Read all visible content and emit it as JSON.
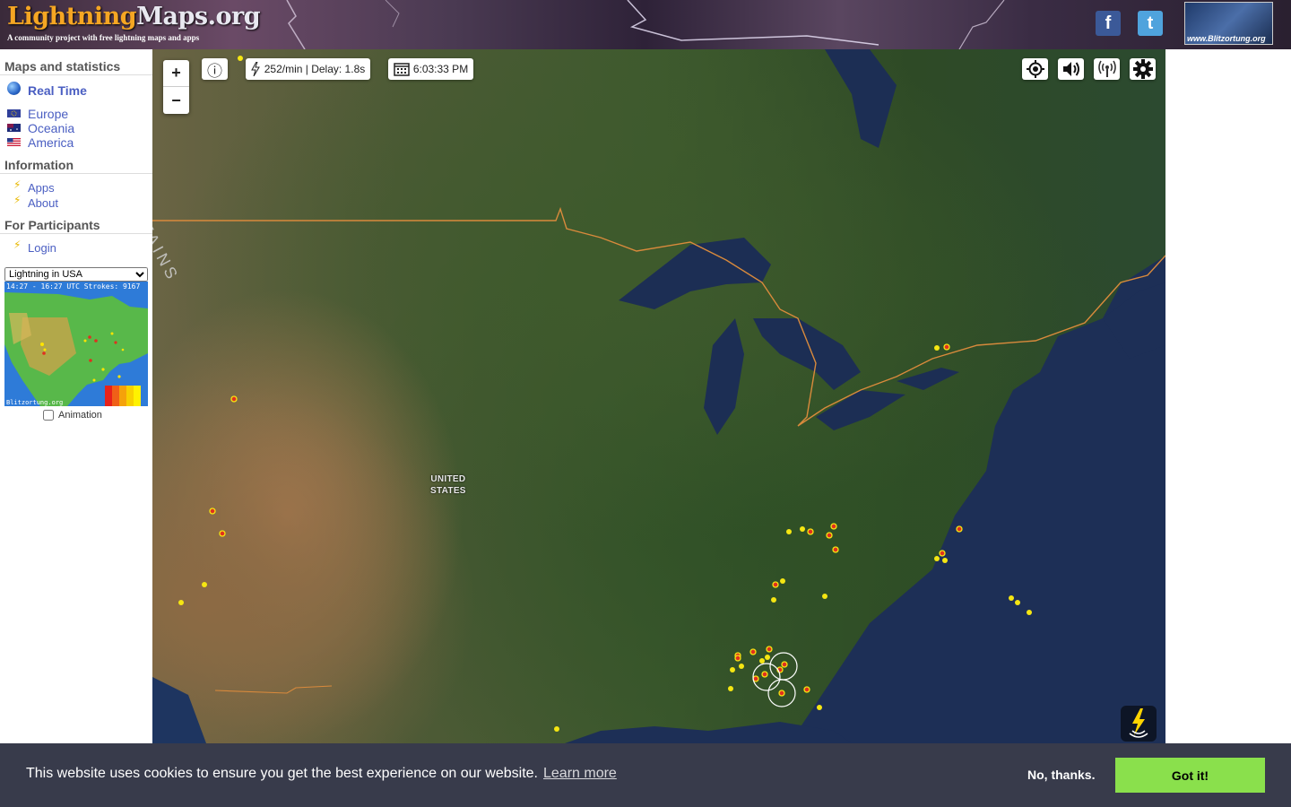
{
  "header": {
    "logo_part1": "Lightning",
    "logo_part2": "Maps.org",
    "tagline": "A community project with free lightning maps and apps",
    "facebook_glyph": "f",
    "twitter_glyph": "t",
    "partner_text": "www.Blitzortung.org"
  },
  "sidebar": {
    "maps_title": "Maps and statistics",
    "realtime_label": "Real Time",
    "regions": [
      "Europe",
      "Oceania",
      "America"
    ],
    "info_title": "Information",
    "info_links": [
      "Apps",
      "About"
    ],
    "participants_title": "For Participants",
    "login_label": "Login",
    "region_select": {
      "selected": "Lightning in USA"
    },
    "mini_map": {
      "caption": "14:27 - 16:27 UTC Strokes: 9167",
      "brand": "Blitzortung.org"
    },
    "animation_label": "Animation"
  },
  "map": {
    "zoom_in": "+",
    "zoom_out": "−",
    "info_glyph": "ⓘ",
    "rate_text": "252/min | Delay: 1.8s",
    "time_text": "6:03:33 PM",
    "country_label_line1": "UNITED",
    "country_label_line2": "STATES",
    "mountains_label": "TAINS",
    "colors": {
      "recent_strike": "#e0301e",
      "older_strike": "#f5e612",
      "border": "#d98a3c"
    }
  },
  "cookie": {
    "message": "This website uses cookies to ensure you get the best experience on our website.",
    "learn_more": "Learn more",
    "decline": "No, thanks.",
    "accept": "Got it!"
  }
}
